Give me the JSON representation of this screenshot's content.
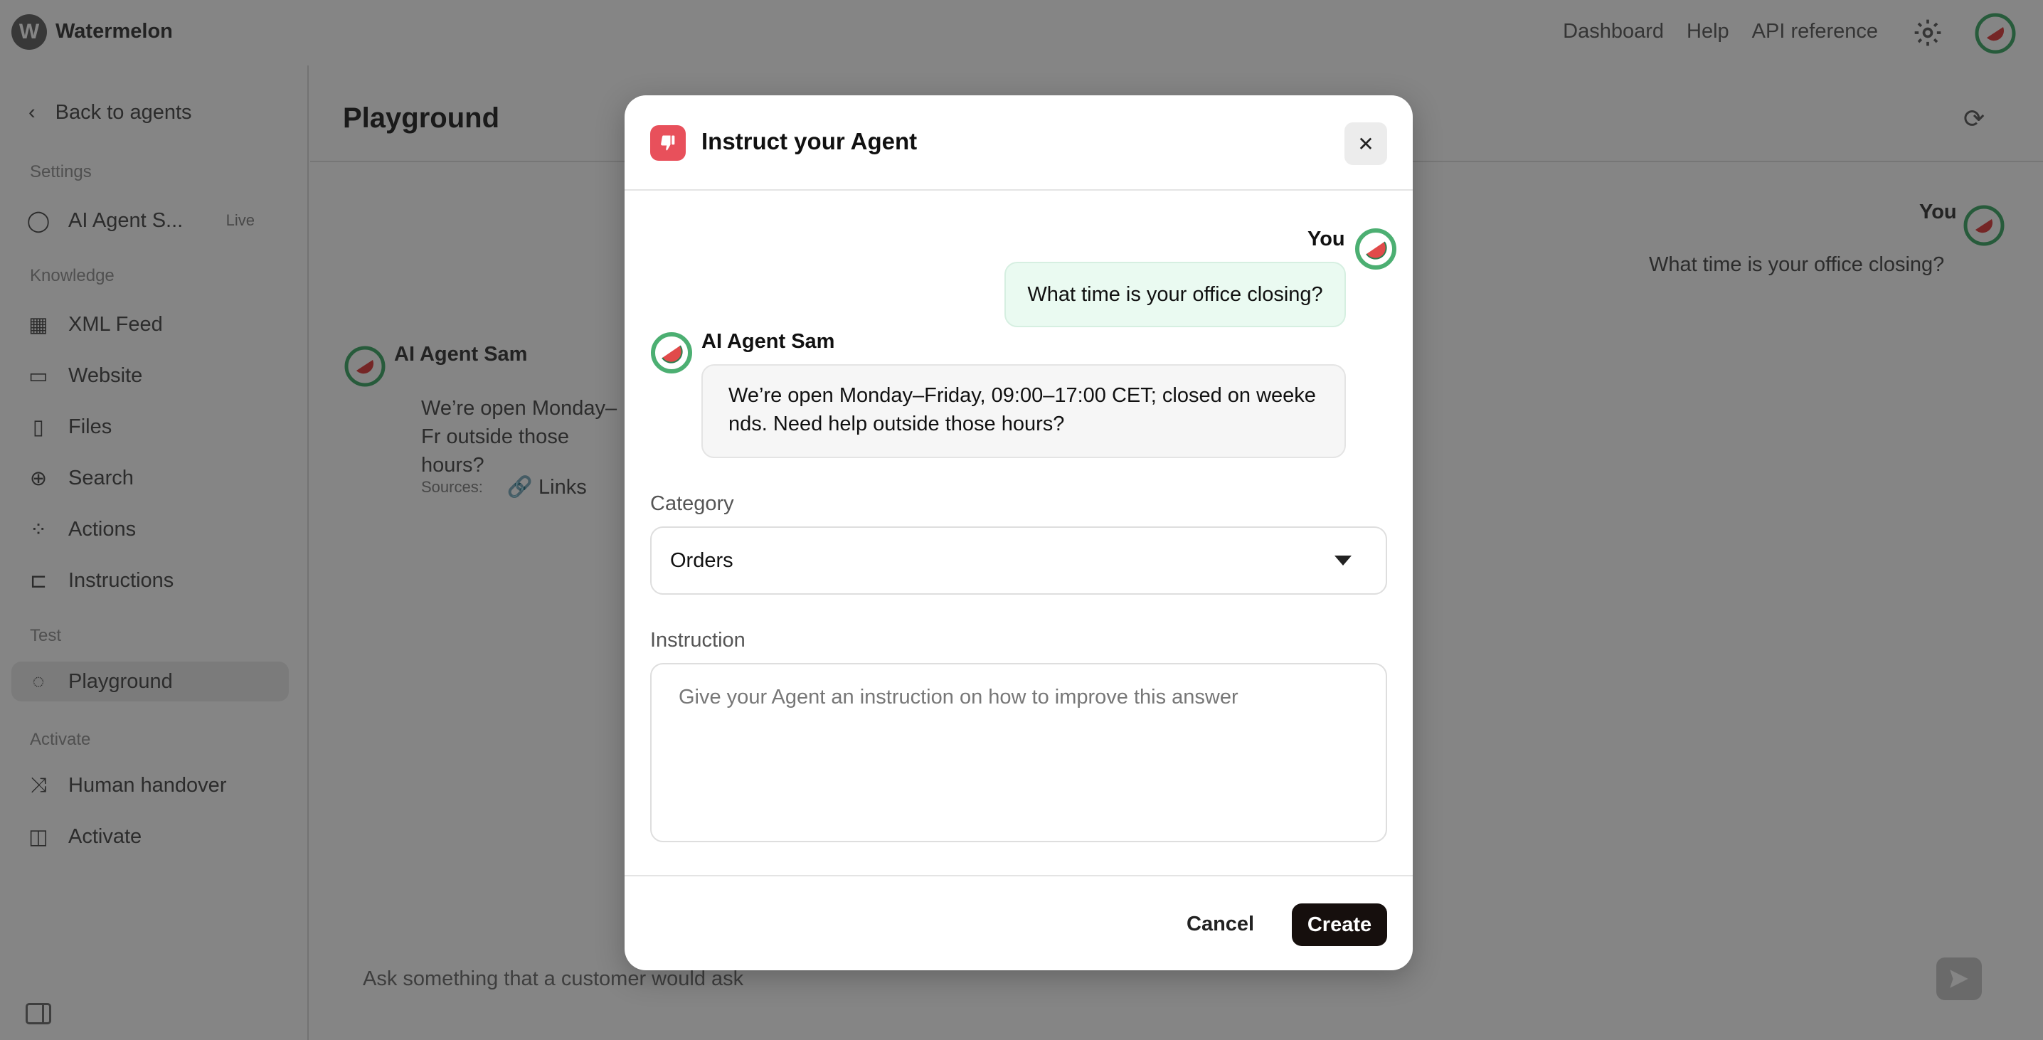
{
  "app": {
    "logo_letter": "W",
    "brand": "Watermelon",
    "nav": [
      "Dashboard",
      "Help",
      "API reference"
    ]
  },
  "sidebar": {
    "back": "Back to agents",
    "sections": {
      "settings": "Settings",
      "knowledge": "Knowledge",
      "test": "Test",
      "activate": "Activate"
    },
    "items": {
      "agent": "AI Agent S...",
      "agent_badge": "Live",
      "xml_feed": "XML Feed",
      "website": "Website",
      "files": "Files",
      "search": "Search",
      "actions": "Actions",
      "instructions": "Instructions",
      "playground": "Playground",
      "human_handover": "Human handover",
      "activate": "Activate"
    }
  },
  "main": {
    "title": "Playground",
    "you_label": "You",
    "question": "What time is your office closing?",
    "ai_name": "AI Agent Sam",
    "ai_text_partial": "We’re open Monday–Fr outside those hours?",
    "sources_label": "Sources:",
    "sources_link": "Links",
    "input_placeholder": "Ask something that a customer would ask"
  },
  "modal": {
    "title": "Instruct your Agent",
    "close_symbol": "✕",
    "you_label": "You",
    "user_message": "What time is your office closing?",
    "ai_name": "AI Agent Sam",
    "ai_message": "We’re open Monday–Friday, 09:00–17:00 CET; closed on weekends. Need help outside those hours?",
    "category_label": "Category",
    "category_value": "Orders",
    "instruction_label": "Instruction",
    "instruction_placeholder": "Give your Agent an instruction on how to improve this answer",
    "cancel_label": "Cancel",
    "create_label": "Create"
  },
  "colors": {
    "accent_red": "#e8505b",
    "avatar_green": "#4caf72",
    "user_bubble": "#eafaf1",
    "primary_button": "#160f0d",
    "overlay": "rgba(0,0,0,0.48)"
  },
  "icons": {
    "thumb": "thumbs-down-icon",
    "avatar": "watermelon-avatar-icon",
    "close": "close-icon",
    "caret": "caret-down-icon"
  }
}
